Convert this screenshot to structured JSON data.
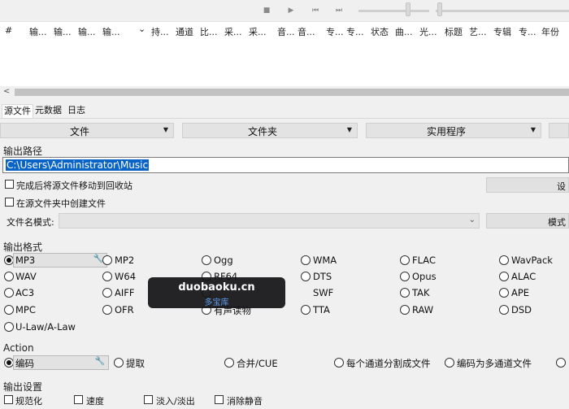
{
  "player": {
    "icons": [
      "stop-icon",
      "play-icon",
      "previous-icon",
      "next-icon"
    ]
  },
  "track_list": {
    "columns": [
      "#",
      "输...",
      "输...",
      "输...",
      "输...",
      "持...",
      "通道",
      "比...",
      "采...",
      "采...",
      "音...",
      "音...",
      "专...",
      "专...",
      "状态",
      "曲...",
      "光...",
      "标题",
      "艺...",
      "专辑",
      "专...",
      "年份"
    ],
    "sort_indicator": "⌄"
  },
  "tabs": [
    "源文件",
    "元数据",
    "日志"
  ],
  "toolbar": {
    "file": "文件",
    "folder": "文件夹",
    "utilities": "实用程序"
  },
  "output_path": {
    "label": "输出路径",
    "value": "C:\\Users\\Administrator\\Music"
  },
  "options": {
    "move_to_recycle": "完成后将源文件移动到回收站",
    "create_in_source": "在源文件夹中创建文件",
    "side_button_1": "设",
    "filename_pattern_label": "文件名模式:",
    "side_button_2": "模式"
  },
  "output_format": {
    "label": "输出格式",
    "rows": [
      [
        "MP3",
        "MP2",
        "Ogg",
        "WMA",
        "FLAC",
        "WavPack"
      ],
      [
        "WAV",
        "W64",
        "RF64",
        "DTS",
        "Opus",
        "ALAC"
      ],
      [
        "AC3",
        "AIFF",
        "SWF",
        "",
        "TAK",
        "APE"
      ],
      [
        "MPC",
        "OFR",
        "有声读物",
        "TTA",
        "RAW",
        "DSD"
      ],
      [
        "U-Law/A-Law"
      ]
    ],
    "selected": "MP3"
  },
  "action": {
    "label": "Action",
    "items": [
      "编码",
      "提取",
      "合并/CUE",
      "每个通道分割成文件",
      "编码为多通道文件"
    ],
    "selected": "编码"
  },
  "output_settings": {
    "label": "输出设置",
    "items": [
      "规范化",
      "速度",
      "淡入/淡出",
      "消除静音"
    ]
  },
  "watermark": {
    "line1": "duobaoku.cn",
    "line2": "多宝库"
  }
}
